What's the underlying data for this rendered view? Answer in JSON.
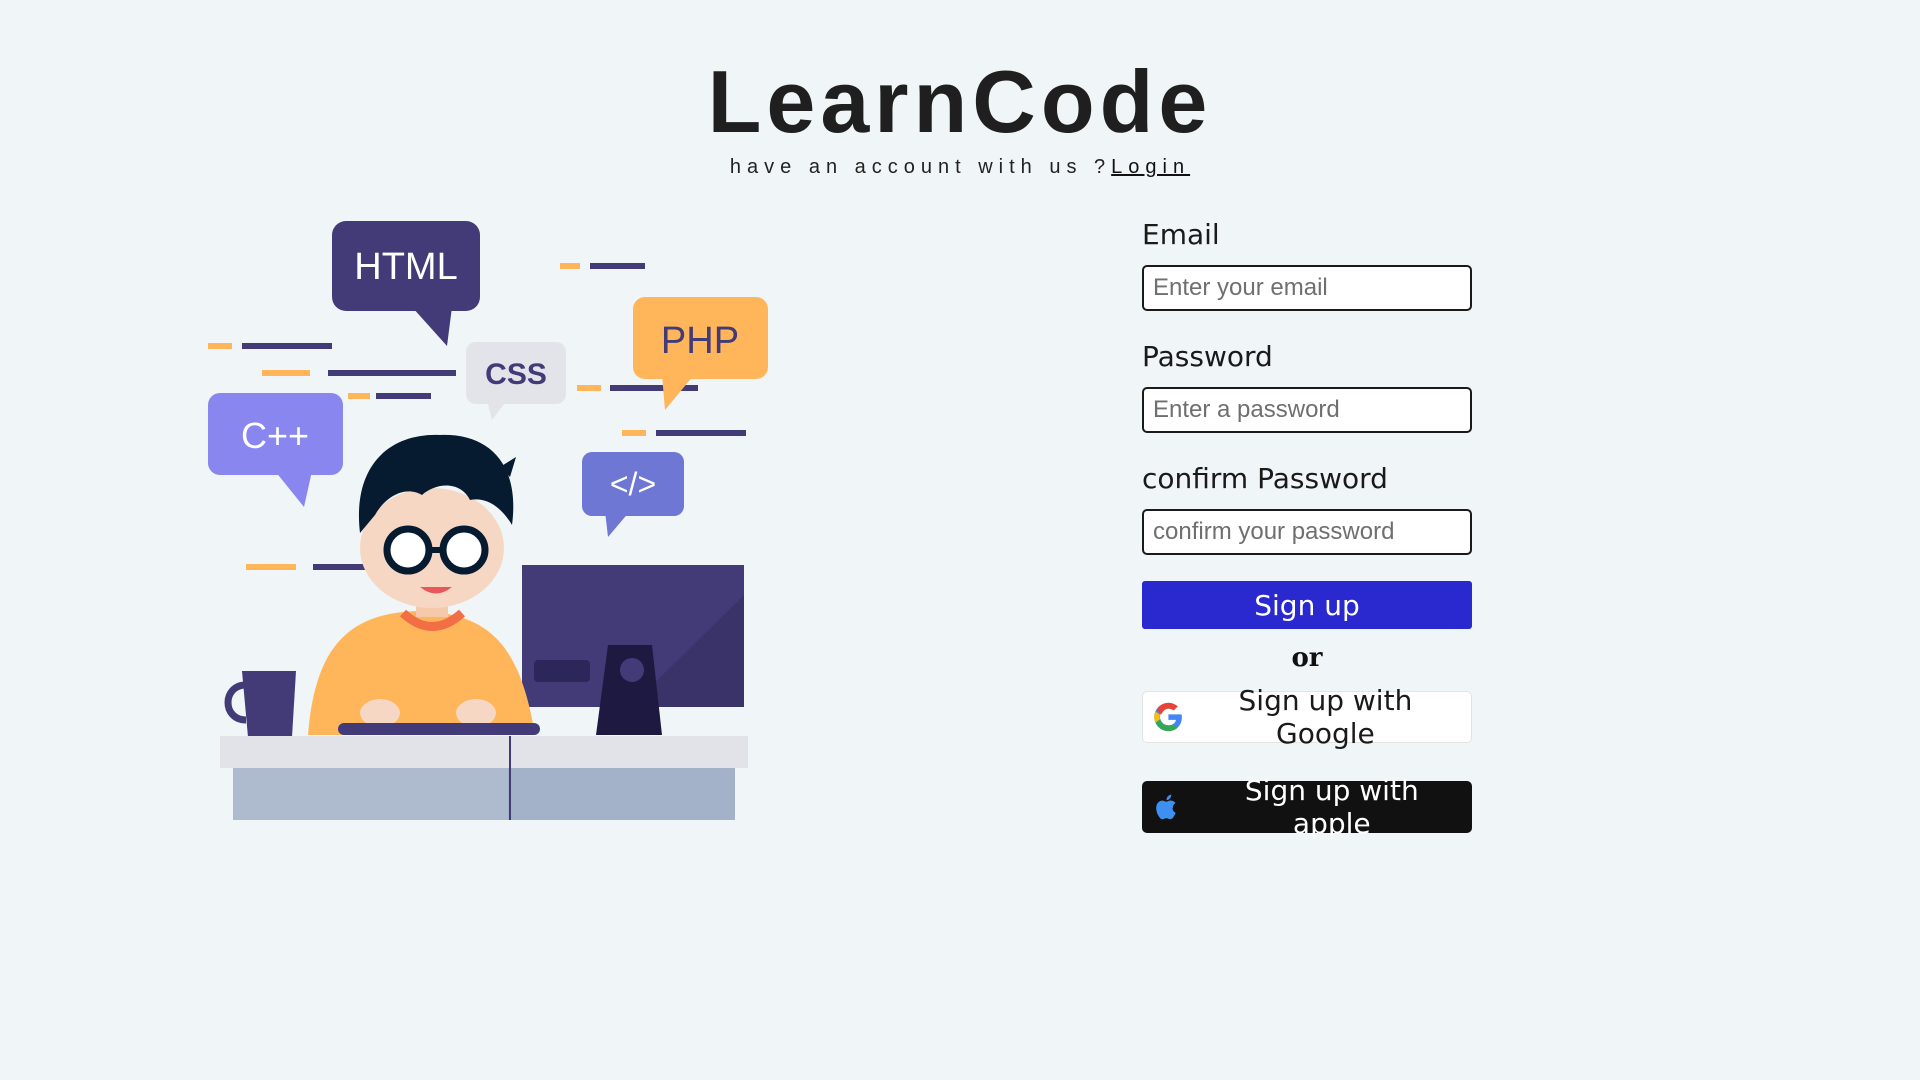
{
  "header": {
    "title": "LearnCode",
    "subtitle": "have an account with us ?",
    "login_link": "Login"
  },
  "illustration": {
    "bubble_labels": [
      "HTML",
      "CSS",
      "PHP",
      "C++",
      "</>"
    ],
    "colors": {
      "navy": "#433b78",
      "orange": "#ffb55a",
      "lavender": "#8a86f0",
      "light_gray": "#e3e3ea",
      "periwinkle": "#6e78d4",
      "desk_top": "#e1e3e8",
      "desk_front": "#aebbcf"
    }
  },
  "form": {
    "email_label": "Email",
    "email_placeholder": "Enter your email",
    "password_label": "Password",
    "password_placeholder": "Enter a password",
    "confirm_label": "confirm Password",
    "confirm_placeholder": "confirm your password",
    "signup_button": "Sign up",
    "or_text": "or",
    "google_button": "Sign up with Google",
    "apple_button": "Sign up with apple",
    "google_icon": "google-icon",
    "apple_icon": "apple-icon"
  },
  "theme": {
    "background": "#f0f5f7",
    "primary": "#2a28cf",
    "apple_bg": "#111111",
    "apple_icon_color": "#3d8ff0"
  }
}
